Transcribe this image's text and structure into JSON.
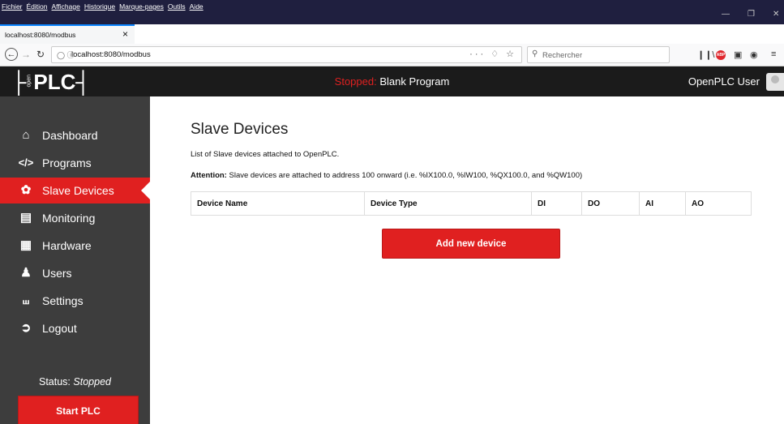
{
  "browser": {
    "menus": [
      "Fichier",
      "Édition",
      "Affichage",
      "Historique",
      "Marque-pages",
      "Outils",
      "Aide"
    ],
    "tab_title": "localhost:8080/modbus",
    "url": "localhost:8080/modbus",
    "search_placeholder": "Rechercher",
    "accent_color": "#0a84ff"
  },
  "header": {
    "logo_small": "open",
    "logo_text": "PLC",
    "status_word": "Stopped:",
    "program": "Blank Program",
    "user": "OpenPLC User"
  },
  "sidebar": {
    "items": [
      {
        "label": "Dashboard",
        "icon": "home-icon",
        "active": false
      },
      {
        "label": "Programs",
        "icon": "code-icon",
        "active": false
      },
      {
        "label": "Slave Devices",
        "icon": "cog-cluster-icon",
        "active": true
      },
      {
        "label": "Monitoring",
        "icon": "monitor-icon",
        "active": false
      },
      {
        "label": "Hardware",
        "icon": "chip-icon",
        "active": false
      },
      {
        "label": "Users",
        "icon": "users-icon",
        "active": false
      },
      {
        "label": "Settings",
        "icon": "screwdriver-icon",
        "active": false
      },
      {
        "label": "Logout",
        "icon": "logout-icon",
        "active": false
      }
    ],
    "status_label": "Status:",
    "status_value": "Stopped",
    "start_button": "Start PLC"
  },
  "main": {
    "title": "Slave Devices",
    "description": "List of Slave devices attached to OpenPLC.",
    "attention_label": "Attention:",
    "attention_text": " Slave devices are attached to address 100 onward (i.e. %IX100.0, %IW100, %QX100.0, and %QW100)",
    "table_headers": [
      "Device Name",
      "Device Type",
      "DI",
      "DO",
      "AI",
      "AO"
    ],
    "add_button": "Add new device"
  },
  "colors": {
    "brand_red": "#e02020",
    "sidebar_bg": "#3d3d3d",
    "header_bg": "#1b1b1b"
  }
}
